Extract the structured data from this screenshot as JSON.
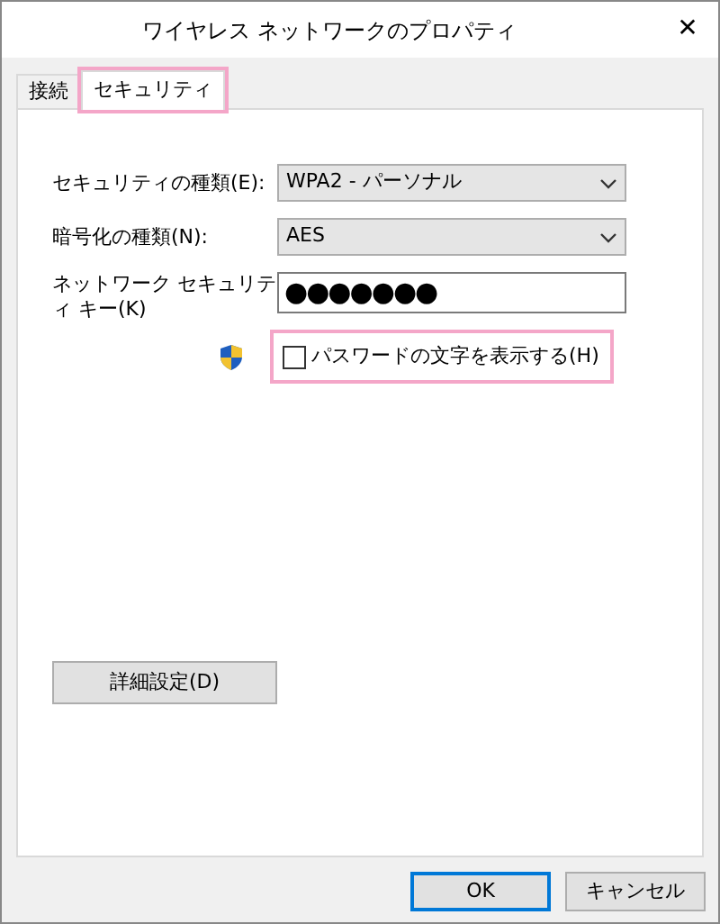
{
  "window": {
    "title": "ワイヤレス ネットワークのプロパティ",
    "close": "✕"
  },
  "tabs": [
    {
      "label": "接続",
      "selected": false,
      "highlighted": false
    },
    {
      "label": "セキュリティ",
      "selected": true,
      "highlighted": true
    }
  ],
  "fields": [
    {
      "kind": "select",
      "label": "セキュリティの種類(E):",
      "value": "WPA2 - パーソナル"
    },
    {
      "kind": "select",
      "label": "暗号化の種類(N):",
      "value": "AES"
    },
    {
      "kind": "password",
      "label": "ネットワーク セキュリティ キー(K)",
      "value": "●●●●●●●"
    }
  ],
  "show_password": {
    "label": "パスワードの文字を表示する(H)",
    "checked": false,
    "highlighted": true
  },
  "advanced_button": "詳細設定(D)",
  "buttons": [
    {
      "label": "OK",
      "default": true
    },
    {
      "label": "キャンセル",
      "default": false
    }
  ]
}
